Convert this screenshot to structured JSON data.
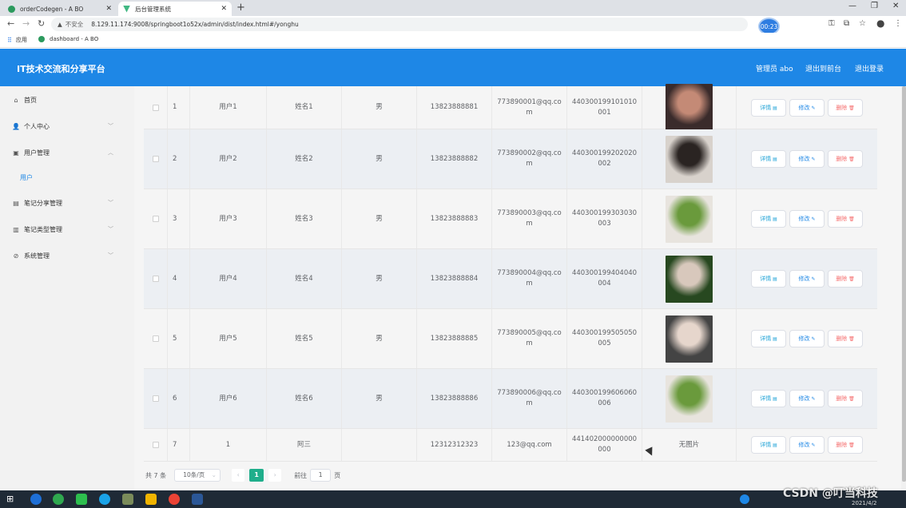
{
  "browser": {
    "tabs": [
      {
        "label": "orderCodegen - A BO",
        "active": false
      },
      {
        "label": "后台管理系统",
        "active": true
      }
    ],
    "url_warning": "不安全",
    "url": "8.129.11.174:9008/springboot1o52x/admin/dist/index.html#/yonghu",
    "timer": "00:23",
    "bookmarks": [
      "应用",
      "dashboard - A BO"
    ]
  },
  "header": {
    "brand": "IT技术交流和分享平台",
    "admin": "管理员 abo",
    "exit_front": "退出到前台",
    "logout": "退出登录",
    "color": "#1e87e6"
  },
  "sidebar": {
    "items": [
      {
        "label": "首页",
        "icon": "home-icon"
      },
      {
        "label": "个人中心",
        "icon": "user-icon"
      },
      {
        "label": "用户管理",
        "icon": "folder-icon"
      },
      {
        "label": "笔记分享管理",
        "icon": "bank-icon"
      },
      {
        "label": "笔记类型管理",
        "icon": "chart-icon"
      },
      {
        "label": "系统管理",
        "icon": "settings-icon"
      }
    ],
    "sub_item": "用户"
  },
  "table": {
    "rows": [
      {
        "no": "1",
        "account": "用户1",
        "name": "姓名1",
        "gender": "男",
        "phone": "13823888881",
        "email": "773890001@qq.com",
        "idcard": "440300199101010001",
        "photo": true
      },
      {
        "no": "2",
        "account": "用户2",
        "name": "姓名2",
        "gender": "男",
        "phone": "13823888882",
        "email": "773890002@qq.com",
        "idcard": "440300199202020002",
        "photo": true
      },
      {
        "no": "3",
        "account": "用户3",
        "name": "姓名3",
        "gender": "男",
        "phone": "13823888883",
        "email": "773890003@qq.com",
        "idcard": "440300199303030003",
        "photo": true
      },
      {
        "no": "4",
        "account": "用户4",
        "name": "姓名4",
        "gender": "男",
        "phone": "13823888884",
        "email": "773890004@qq.com",
        "idcard": "440300199404040004",
        "photo": true
      },
      {
        "no": "5",
        "account": "用户5",
        "name": "姓名5",
        "gender": "男",
        "phone": "13823888885",
        "email": "773890005@qq.com",
        "idcard": "440300199505050005",
        "photo": true
      },
      {
        "no": "6",
        "account": "用户6",
        "name": "姓名6",
        "gender": "男",
        "phone": "13823888886",
        "email": "773890006@qq.com",
        "idcard": "440300199606060006",
        "photo": true
      },
      {
        "no": "7",
        "account": "1",
        "name": "阿三",
        "gender": "",
        "phone": "12312312323",
        "email": "123@qq.com",
        "idcard": "441402000000000000",
        "photo": false,
        "photo_text": "无图片"
      }
    ],
    "actions": {
      "detail": "详情",
      "edit": "修改",
      "delete": "删除"
    }
  },
  "pagination": {
    "total": "共 7 条",
    "page_size": "10条/页",
    "current": "1",
    "goto_prefix": "前往",
    "goto_value": "1",
    "goto_suffix": "页"
  },
  "taskbar": {
    "watermark": "CSDN @叮当科技",
    "date": "2021/4/2"
  }
}
